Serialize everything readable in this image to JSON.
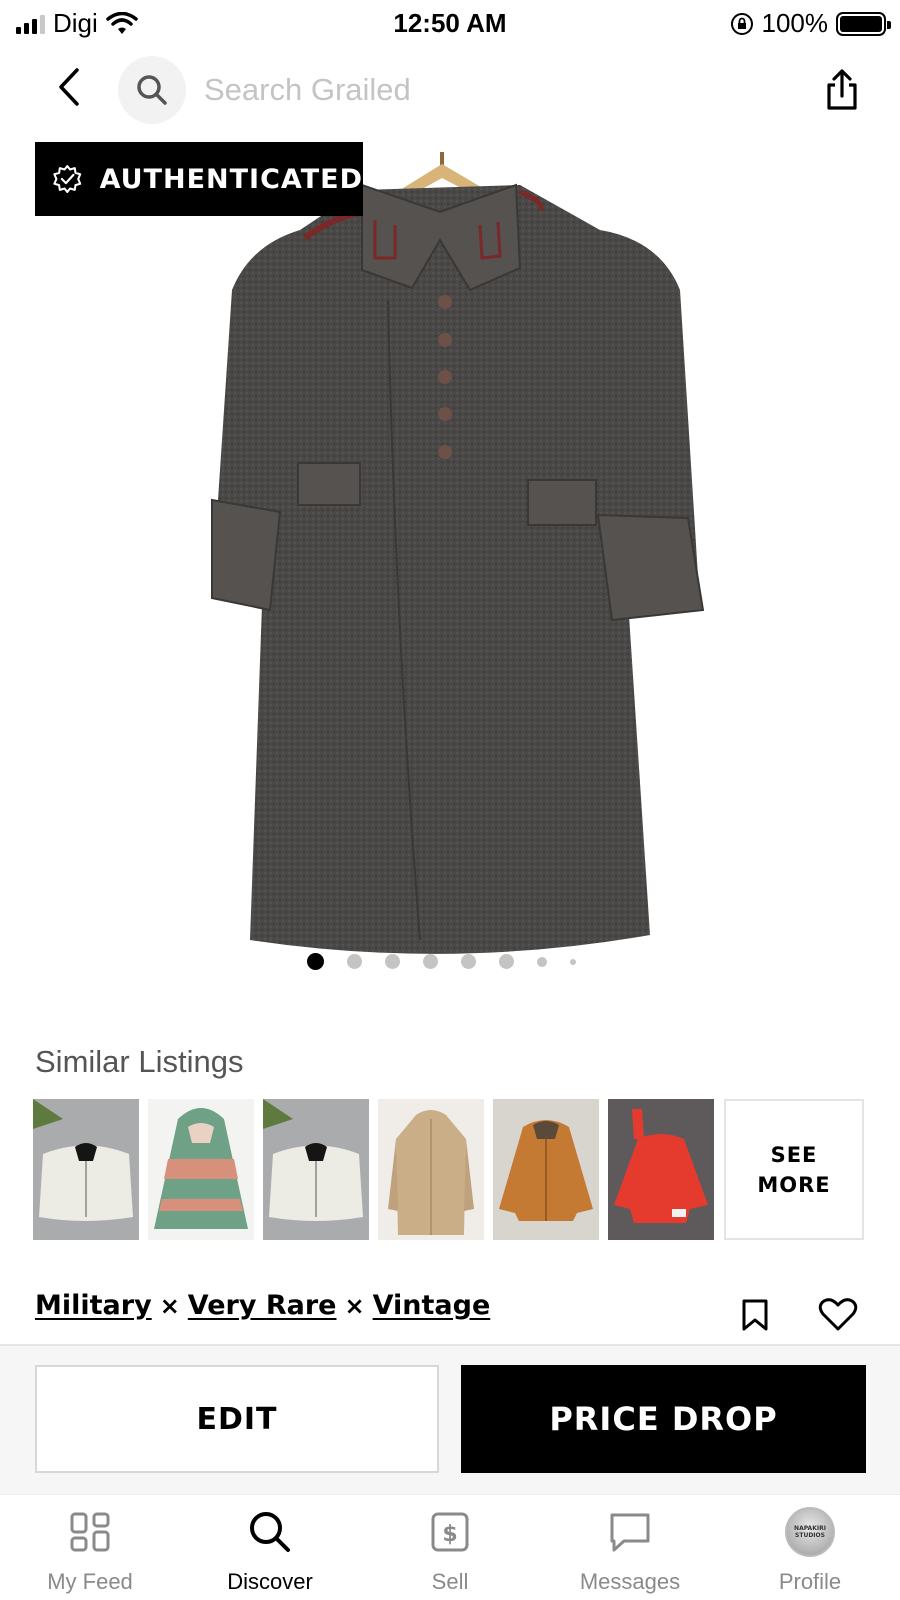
{
  "status_bar": {
    "carrier": "Digi",
    "time": "12:50 AM",
    "battery": "100%"
  },
  "search": {
    "placeholder": "Search Grailed"
  },
  "listing": {
    "authenticated_label": "AUTHENTICATED",
    "photo_count": 8,
    "active_photo": 1,
    "designers": [
      "Military",
      "Very Rare",
      "Vintage"
    ],
    "designer_separator": "×"
  },
  "similar": {
    "title": "Similar Listings",
    "see_more": "SEE\nMORE"
  },
  "actions": {
    "edit_label": "EDIT",
    "price_drop_label": "PRICE DROP"
  },
  "tabs": {
    "my_feed": "My Feed",
    "discover": "Discover",
    "sell": "Sell",
    "messages": "Messages",
    "profile": "Profile",
    "avatar_text": "NAPAKIRI STUDIOS"
  },
  "colors": {
    "accent": "#000000",
    "coat": "#4a4846",
    "placeholder": "#c4c4c4"
  }
}
